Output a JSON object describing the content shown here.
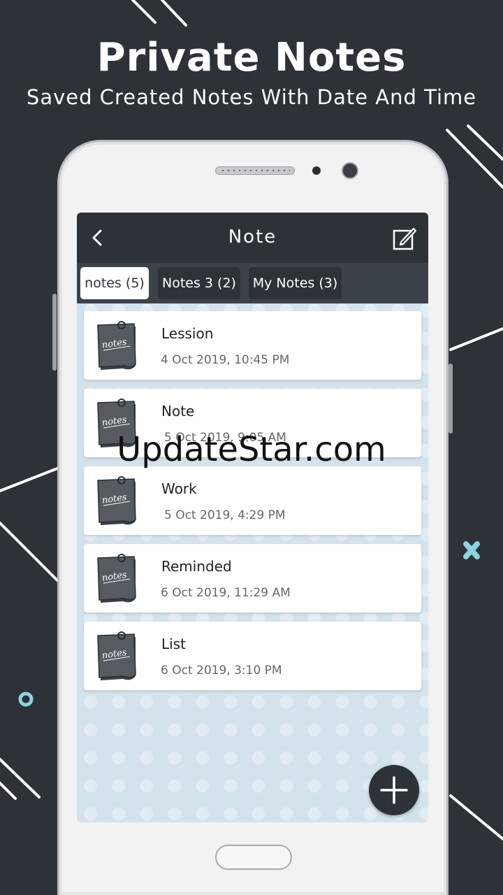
{
  "banner": {
    "headline": "Private Notes",
    "subline": "Saved Created Notes With Date And Time"
  },
  "app": {
    "title": "Note",
    "back_icon": "chevron-left-icon",
    "edit_icon": "edit-note-icon",
    "tabs": [
      {
        "label": "notes (5)",
        "active": true
      },
      {
        "label": "Notes 3 (2)",
        "active": false
      },
      {
        "label": "My Notes (3)",
        "active": false
      }
    ],
    "notes": [
      {
        "title": "Lession",
        "date": "4 Oct 2019, 10:45 PM",
        "icon": "notes-pad-icon"
      },
      {
        "title": "Note",
        "date": "5 Oct 2019, 9:05 AM",
        "icon": "notes-pad-icon"
      },
      {
        "title": "Work",
        "date": "5 Oct 2019, 4:29 PM",
        "icon": "notes-pad-icon"
      },
      {
        "title": "Reminded",
        "date": "6 Oct 2019, 11:29 AM",
        "icon": "notes-pad-icon"
      },
      {
        "title": "List",
        "date": "6 Oct 2019, 3:10 PM",
        "icon": "notes-pad-icon"
      }
    ],
    "fab_icon": "plus-icon",
    "note_icon_text": "notes"
  },
  "watermark": "UpdateStar.com",
  "colors": {
    "background": "#2c3238",
    "screen_bg": "#d4e2ec",
    "accent_cyan": "#8fd3e0",
    "card": "#ffffff"
  }
}
